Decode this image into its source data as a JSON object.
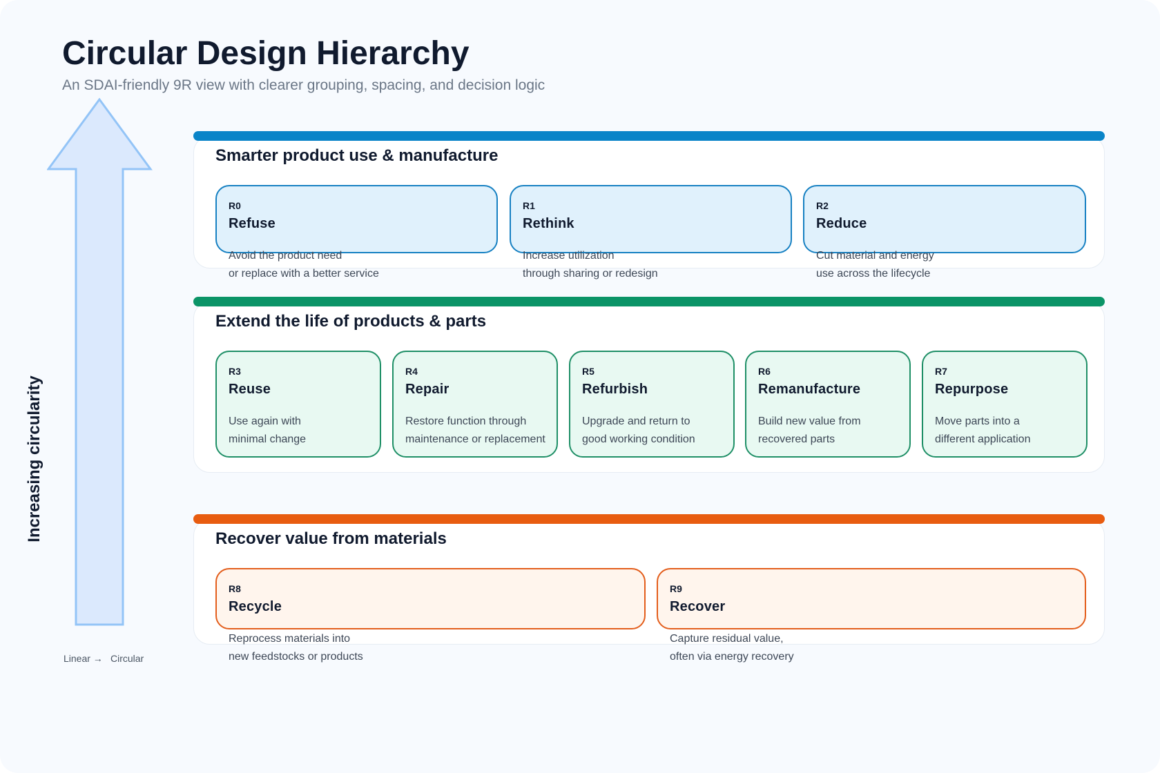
{
  "header": {
    "title": "Circular Design Hierarchy",
    "subtitle": "An SDAI-friendly 9R view with clearer grouping, spacing, and decision logic"
  },
  "axis": {
    "label": "Increasing circularity",
    "footer_left": "Linear →",
    "footer_right": "Circular"
  },
  "colors": {
    "blue": "#0a84c8",
    "green": "#0b9467",
    "orange": "#e85c10",
    "arrow_fill": "#dbe9fd",
    "arrow_stroke": "#93c4f7"
  },
  "groups": [
    {
      "title": "Smarter product use & manufacture",
      "items": [
        {
          "code": "R0",
          "name": "Refuse",
          "desc": [
            "Avoid the product need",
            "or replace with a better service"
          ]
        },
        {
          "code": "R1",
          "name": "Rethink",
          "desc": [
            "Increase utilization",
            "through sharing or redesign"
          ]
        },
        {
          "code": "R2",
          "name": "Reduce",
          "desc": [
            "Cut material and energy",
            "use across the lifecycle"
          ]
        }
      ]
    },
    {
      "title": "Extend the life of products & parts",
      "items": [
        {
          "code": "R3",
          "name": "Reuse",
          "desc": [
            "Use again with",
            "minimal change"
          ]
        },
        {
          "code": "R4",
          "name": "Repair",
          "desc": [
            "Restore function through",
            "maintenance or replacement"
          ]
        },
        {
          "code": "R5",
          "name": "Refurbish",
          "desc": [
            "Upgrade and return to",
            "good working condition"
          ]
        },
        {
          "code": "R6",
          "name": "Remanufacture",
          "desc": [
            "Build new value from",
            "recovered parts"
          ]
        },
        {
          "code": "R7",
          "name": "Repurpose",
          "desc": [
            "Move parts into a",
            "different application"
          ]
        }
      ]
    },
    {
      "title": "Recover value from materials",
      "items": [
        {
          "code": "R8",
          "name": "Recycle",
          "desc": [
            "Reprocess materials into",
            "new feedstocks or products"
          ]
        },
        {
          "code": "R9",
          "name": "Recover",
          "desc": [
            "Capture residual value,",
            "often via energy recovery"
          ]
        }
      ]
    }
  ]
}
